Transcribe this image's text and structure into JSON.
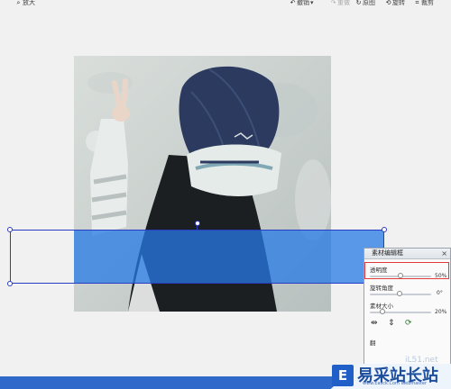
{
  "toolbar": {
    "left_label": "放大",
    "undo_label": "撤销",
    "redo_label": "重做",
    "original_label": "原图",
    "rotate_label": "旋转",
    "crop_label": "裁剪"
  },
  "panel": {
    "title": "素材编辑框",
    "close": "×",
    "opacity_label": "透明度",
    "opacity_value": "50%",
    "opacity_level": 0.5,
    "rotation_label": "旋转角度",
    "rotation_value": "0°",
    "size_label": "素材大小",
    "size_value": "20%",
    "size_level": 0.2,
    "bottom_label": "翻"
  },
  "watermark": {
    "logo_char": "E",
    "title": "易采站长站",
    "url": "www.Easck.Com Webmaster",
    "ghost": "iL51.net"
  },
  "colors": {
    "overlay_blue": "#257ae6",
    "selection_frame": "#2b3cc4",
    "highlight_red": "#e23b3b",
    "bottom_bar": "#2f69c9"
  }
}
